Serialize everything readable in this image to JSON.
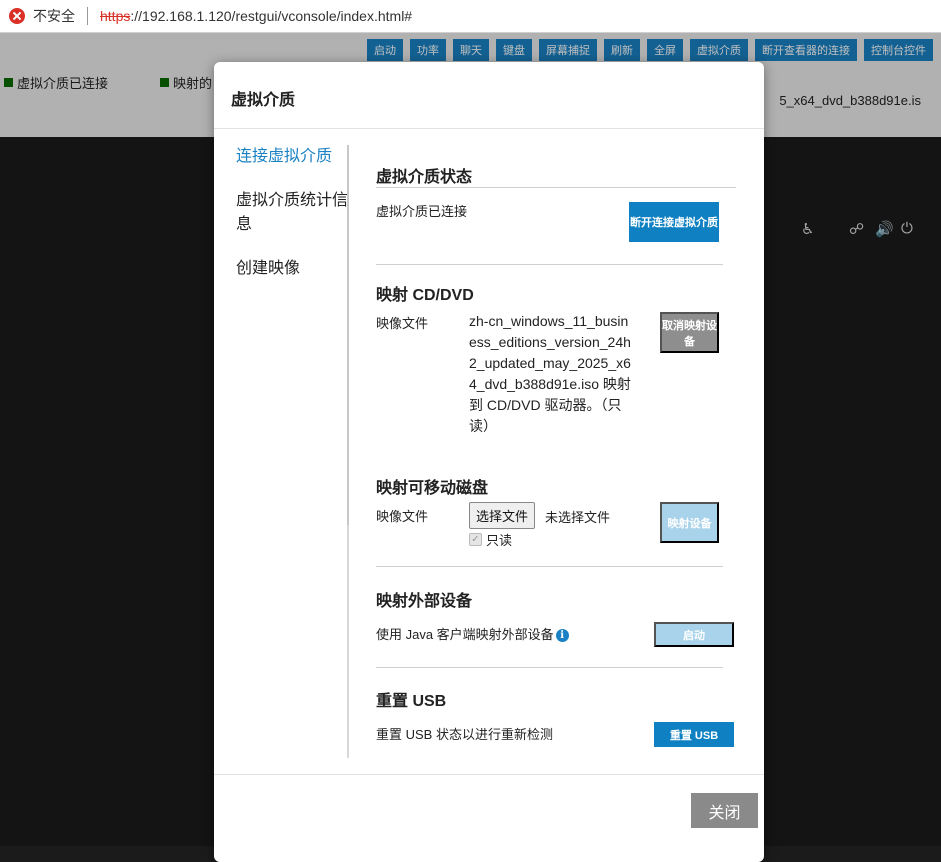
{
  "browser": {
    "insecure_label": "不安全",
    "url_scheme": "https",
    "url_rest": "://192.168.1.120/restgui/vconsole/index.html#"
  },
  "toolbar": {
    "buttons": [
      "启动",
      "功率",
      "聊天",
      "键盘",
      "屏幕捕捉",
      "刷新",
      "全屏",
      "虚拟介质",
      "断开查看器的连接",
      "控制台控件"
    ],
    "status_left_1": "虚拟介质已连接",
    "status_left_2": "映射的",
    "status_right": "5_x64_dvd_b388d91e.is"
  },
  "console_icons": [
    "accessibility-icon",
    "network-icon",
    "volume-icon",
    "power-icon"
  ],
  "modal": {
    "title": "虚拟介质",
    "nav": [
      {
        "label": "连接虚拟介质",
        "active": true
      },
      {
        "label": "虚拟介质统计信息",
        "active": false
      },
      {
        "label": "创建映像",
        "active": false
      }
    ],
    "status_section": {
      "title": "虚拟介质状态",
      "text": "虚拟介质已连接",
      "button": "断开连接虚拟介质"
    },
    "cd_section": {
      "title": "映射 CD/DVD",
      "label": "映像文件",
      "value": "zh-cn_windows_11_business_editions_version_24h2_updated_may_2025_x64_dvd_b388d91e.iso 映射到 CD/DVD 驱动器。（只读）",
      "button": "取消映射设备"
    },
    "removable_section": {
      "title": "映射可移动磁盘",
      "label": "映像文件",
      "file_button": "选择文件",
      "file_status": "未选择文件",
      "readonly_label": "只读",
      "button": "映射设备"
    },
    "external_section": {
      "title": "映射外部设备",
      "text": "使用 Java 客户端映射外部设备",
      "button": "启动"
    },
    "usb_section": {
      "title": "重置 USB",
      "text": "重置 USB 状态以进行重新检测",
      "button": "重置 USB"
    },
    "close_button": "关闭"
  },
  "colors": {
    "accent": "#0f80c1",
    "status_green": "#0a6b00",
    "disabled_button": "#a9d3ea",
    "gray_button": "#8e8e8e"
  }
}
